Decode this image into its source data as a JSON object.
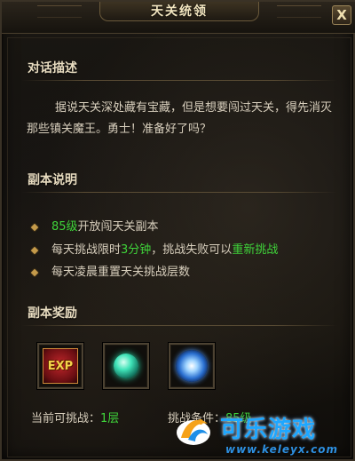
{
  "window": {
    "title": "天关统领",
    "close_label": "X"
  },
  "dialog_section": {
    "heading": "对话描述",
    "text": "据说天关深处藏有宝藏，但是想要闯过天关，得先消灭那些镇关魔王。勇士！准备好了吗？"
  },
  "instance_section": {
    "heading": "副本说明",
    "items": [
      {
        "green_prefix": "85级",
        "text": "开放闯天关副本"
      },
      {
        "text_a": "每天挑战限时",
        "green_mid": "3分钟",
        "text_b": "，挑战失败可以",
        "green_end": "重新挑战"
      },
      {
        "text": "每天凌晨重置天关挑战层数"
      }
    ]
  },
  "reward_section": {
    "heading": "副本奖励",
    "rewards": [
      {
        "icon": "exp-icon",
        "label": "EXP"
      },
      {
        "icon": "green-orb-icon"
      },
      {
        "icon": "blue-orb-icon"
      }
    ]
  },
  "footer": {
    "current_label": "当前可挑战：",
    "current_value": "1层",
    "condition_label": "挑战条件：",
    "condition_value": "85级"
  },
  "watermark": {
    "text": "可乐游戏",
    "url": "www.keleyx.com"
  },
  "colors": {
    "accent_green": "#3fd43a",
    "heading": "#e8dcc0",
    "body_text": "#d8cfbd"
  }
}
